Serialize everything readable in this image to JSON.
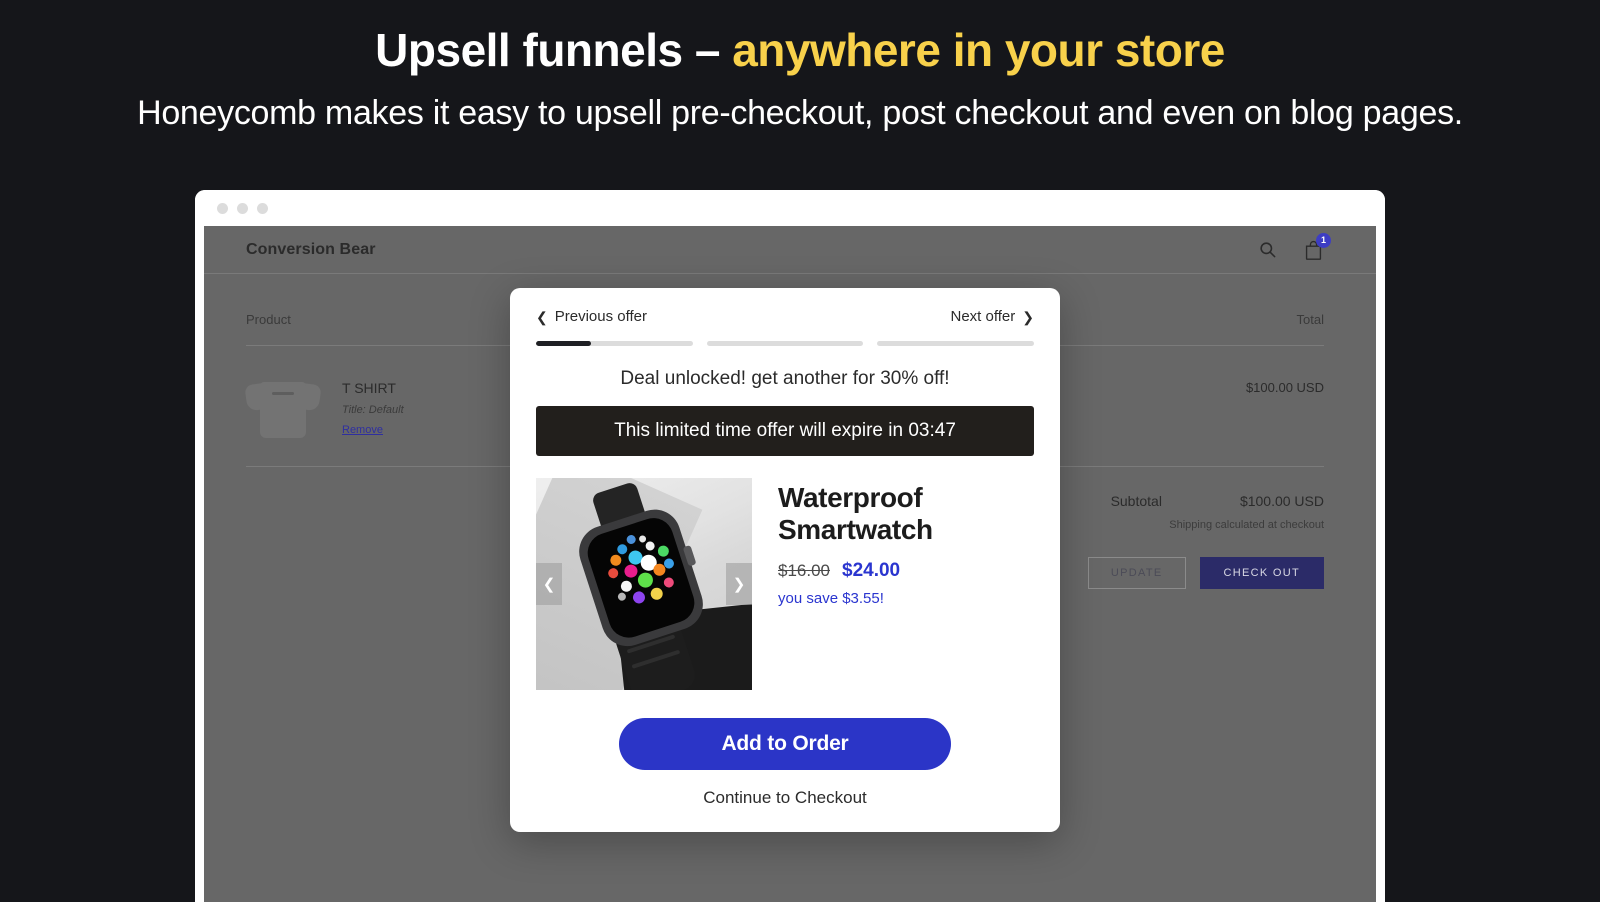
{
  "hero": {
    "title_plain": "Upsell funnels – ",
    "title_accent": "anywhere in your store",
    "subtitle": "Honeycomb makes it easy to upsell pre-checkout, post checkout and even on blog pages.",
    "accent_color": "#f8d14b"
  },
  "store": {
    "name": "Conversion Bear",
    "search_icon": "search-icon",
    "cart_icon": "shopping-bag-icon",
    "cart_count": "1",
    "cart_badge_color": "#3d3dc4",
    "columns": {
      "product": "Product",
      "total": "Total"
    },
    "item": {
      "title": "T SHIRT",
      "variant": "Title: Default",
      "remove": "Remove",
      "line_total": "$100.00 USD"
    },
    "subtotal_label": "Subtotal",
    "subtotal_value": "$100.00 USD",
    "shipping_note": "Shipping calculated at checkout",
    "update_button": "UPDATE",
    "checkout_button": "CHECK OUT"
  },
  "modal": {
    "previous_offer": "Previous offer",
    "next_offer": "Next offer",
    "prev_icon": "chevron-left-icon",
    "next_icon": "chevron-right-icon",
    "progress": [
      35,
      0,
      0
    ],
    "deal_text": "Deal unlocked! get another for 30% off!",
    "timer_text": "This limited time offer will expire in 03:47",
    "timer_value": "03:47",
    "carousel_prev_icon": "chevron-left-icon",
    "carousel_next_icon": "chevron-right-icon",
    "product_image_alt": "Waterproof Smartwatch product photo",
    "product_title": "Waterproof Smartwatch",
    "price_old": "$16.00",
    "price_new": "$24.00",
    "save_text": "you save $3.55!",
    "add_button": "Add to Order",
    "continue_link": "Continue to Checkout",
    "accent_color": "#2b35c7"
  }
}
